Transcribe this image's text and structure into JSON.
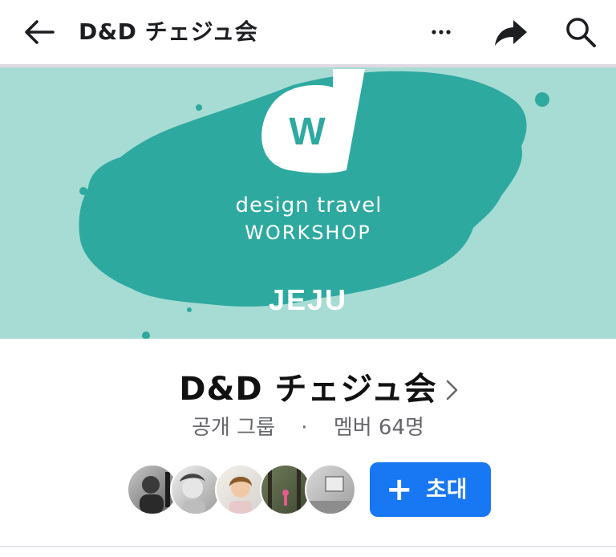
{
  "header": {
    "title": "D&D チェジュ会",
    "back_icon": "arrow-left-icon",
    "more_icon": "more-horizontal-icon",
    "share_icon": "share-icon",
    "search_icon": "search-icon"
  },
  "cover": {
    "line1": "design travel",
    "line2": "WORKSHOP",
    "place": "JEJU",
    "badge_letter": "W",
    "colors": {
      "background": "#a6dcd4",
      "island": "#2ea9a0"
    }
  },
  "group": {
    "name": "D&D チェジュ会",
    "privacy": "공개 그룹",
    "separator": "·",
    "members": "멤버 64명"
  },
  "invite_button": {
    "label": "초대",
    "icon": "plus-icon",
    "color": "#1877f2"
  },
  "member_avatars": [
    "avatar-1",
    "avatar-2",
    "avatar-3",
    "avatar-4",
    "avatar-5"
  ]
}
